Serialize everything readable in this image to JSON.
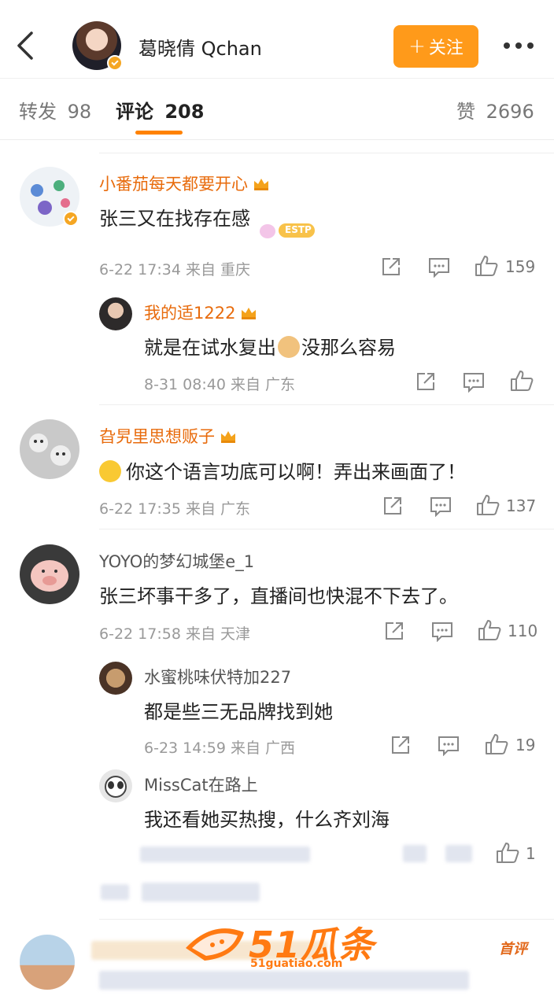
{
  "header": {
    "username": "葛晓倩 Qchan",
    "follow_label": "关注",
    "follow_plus": "+"
  },
  "tabs": {
    "repost_label": "转发",
    "repost_count": "98",
    "comment_label": "评论",
    "comment_count": "208",
    "like_label": "赞",
    "like_count": "2696"
  },
  "comments": [
    {
      "user": "小番茄每天都要开心",
      "text": "张三又在找存在感",
      "meta": "6-22 17:34 来自 重庆",
      "likes": "159",
      "badge_text": "ESTP",
      "replies": [
        {
          "user": "我的适1222",
          "text_before": "就是在试水复出",
          "text_after": "没那么容易",
          "meta": "8-31 08:40 来自 广东",
          "likes": ""
        }
      ]
    },
    {
      "user": "旮旯里思想贩子",
      "text": "你这个语言功底可以啊！弄出来画面了！",
      "meta": "6-22 17:35 来自 广东",
      "likes": "137"
    },
    {
      "user": "YOYO的梦幻城堡e_1",
      "text": "张三坏事干多了，直播间也快混不下去了。",
      "meta": "6-22 17:58 来自 天津",
      "likes": "110",
      "replies": [
        {
          "user": "水蜜桃味伏特加227",
          "text": "都是些三无品牌找到她",
          "meta": "6-23 14:59 来自 广西",
          "likes": "19"
        },
        {
          "user": "MissCat在路上",
          "text": "我还看她买热搜，什么齐刘海",
          "meta": "",
          "likes": "1"
        }
      ]
    }
  ],
  "watermark": {
    "logo_text": "51瓜条",
    "logo_sub": "51guatiao.com",
    "corner_text": "首评"
  },
  "colors": {
    "accent": "#ff8200",
    "vip_name": "#e86b0c",
    "meta": "#999999"
  }
}
